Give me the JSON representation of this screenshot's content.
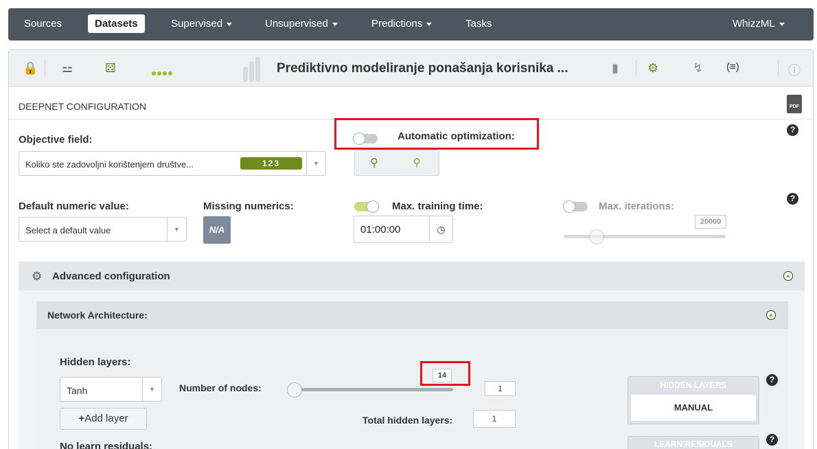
{
  "nav": {
    "items": [
      {
        "label": "Sources",
        "active": false,
        "caret": false
      },
      {
        "label": "Datasets",
        "active": true,
        "caret": false
      },
      {
        "label": "Supervised",
        "active": false,
        "caret": true
      },
      {
        "label": "Unsupervised",
        "active": false,
        "caret": true
      },
      {
        "label": "Predictions",
        "active": false,
        "caret": true
      },
      {
        "label": "Tasks",
        "active": false,
        "caret": false
      }
    ],
    "right_menu": "WhizzML"
  },
  "toolbar": {
    "dataset_title": "Prediktivno modeliranje ponašanja korisnika ..."
  },
  "config": {
    "section_title": "DEEPNET CONFIGURATION",
    "pdf_label": "PDF",
    "objective_label": "Objective field:",
    "objective_value": "Koliko ste zadovoljni korištenjem društve...",
    "objective_type_badge": "123",
    "auto_opt_label": "Automatic optimization:",
    "default_numeric_label": "Default numeric value:",
    "default_numeric_placeholder": "Select a default value",
    "missing_numerics_label": "Missing numerics:",
    "missing_numerics_button": "N/A",
    "max_training_label": "Max. training time:",
    "max_training_value": "01:00:00",
    "max_iterations_label": "Max. iterations:",
    "max_iterations_value": "20000",
    "help_glyph": "?"
  },
  "advanced": {
    "title": "Advanced configuration",
    "network": {
      "title": "Network Architecture:",
      "hidden_layers_label": "Hidden layers:",
      "activation_value": "Tanh",
      "nodes_label": "Number of nodes:",
      "nodes_slider_tooltip": "14",
      "nodes_value": "1",
      "add_layer_label": "Add layer",
      "total_hidden_label": "Total hidden layers:",
      "total_hidden_value": "1",
      "no_learn_residuals_label": "No learn residuals:",
      "hidden_layers_card_head": "HIDDEN LAYERS",
      "hidden_layers_card_value": "MANUAL",
      "learn_residuals_card_head": "LEARN RESIDUALS"
    }
  }
}
